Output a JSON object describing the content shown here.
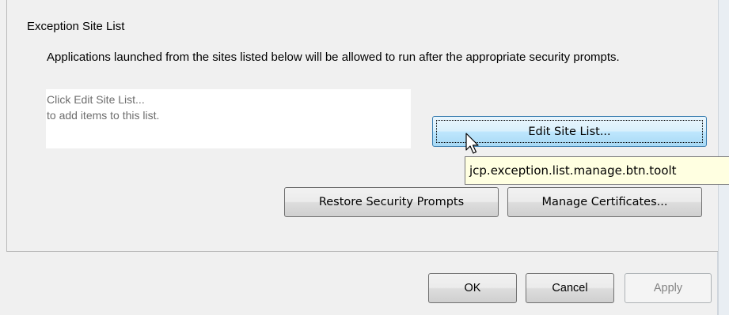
{
  "section": {
    "title": "Exception Site List",
    "description": "Applications launched from the sites listed below will be allowed to run after the appropriate security prompts."
  },
  "site_list": {
    "hint_line1": "Click Edit Site List...",
    "hint_line2": "to add items to this list."
  },
  "buttons": {
    "edit_site_list": "Edit Site List...",
    "restore_prompts": "Restore Security Prompts",
    "manage_certificates": "Manage Certificates...",
    "ok": "OK",
    "cancel": "Cancel",
    "apply": "Apply"
  },
  "tooltip": {
    "text": "jcp.exception.list.manage.btn.toolt"
  },
  "icons": {
    "cursor": "mouse-pointer-icon"
  }
}
